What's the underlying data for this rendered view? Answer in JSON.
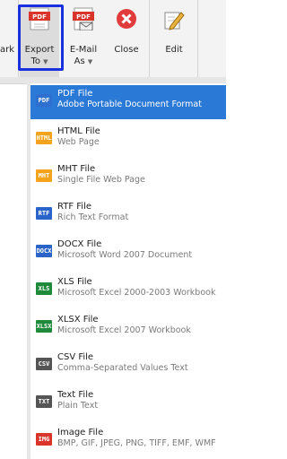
{
  "ribbon": {
    "left_partial_label": "ark",
    "export_label_1": "Export",
    "export_label_2": "To",
    "email_label_1": "E-Mail",
    "email_label_2": "As",
    "close_label": "Close",
    "edit_label": "Edit",
    "pdf_badge": "PDF"
  },
  "menu": {
    "items": [
      {
        "title": "PDF File",
        "desc": "Adobe Portable Document Format",
        "badge": "PDF",
        "color": "#2f6fd0"
      },
      {
        "title": "HTML File",
        "desc": "Web Page",
        "badge": "HTML",
        "color": "#f5a31a"
      },
      {
        "title": "MHT File",
        "desc": "Single File Web Page",
        "badge": "MHT",
        "color": "#f5a31a"
      },
      {
        "title": "RTF File",
        "desc": "Rich Text Format",
        "badge": "RTF",
        "color": "#2a64c8"
      },
      {
        "title": "DOCX File",
        "desc": "Microsoft Word 2007 Document",
        "badge": "DOCX",
        "color": "#2a64c8"
      },
      {
        "title": "XLS File",
        "desc": "Microsoft Excel 2000-2003 Workbook",
        "badge": "XLS",
        "color": "#1f8a3a"
      },
      {
        "title": "XLSX File",
        "desc": "Microsoft Excel 2007 Workbook",
        "badge": "XLSX",
        "color": "#1f8a3a"
      },
      {
        "title": "CSV File",
        "desc": "Comma-Separated Values Text",
        "badge": "CSV",
        "color": "#555555"
      },
      {
        "title": "Text File",
        "desc": "Plain Text",
        "badge": "TXT",
        "color": "#555555"
      },
      {
        "title": "Image File",
        "desc": "BMP, GIF, JPEG, PNG, TIFF, EMF, WMF",
        "badge": "IMG",
        "color": "#d9352b"
      }
    ]
  }
}
